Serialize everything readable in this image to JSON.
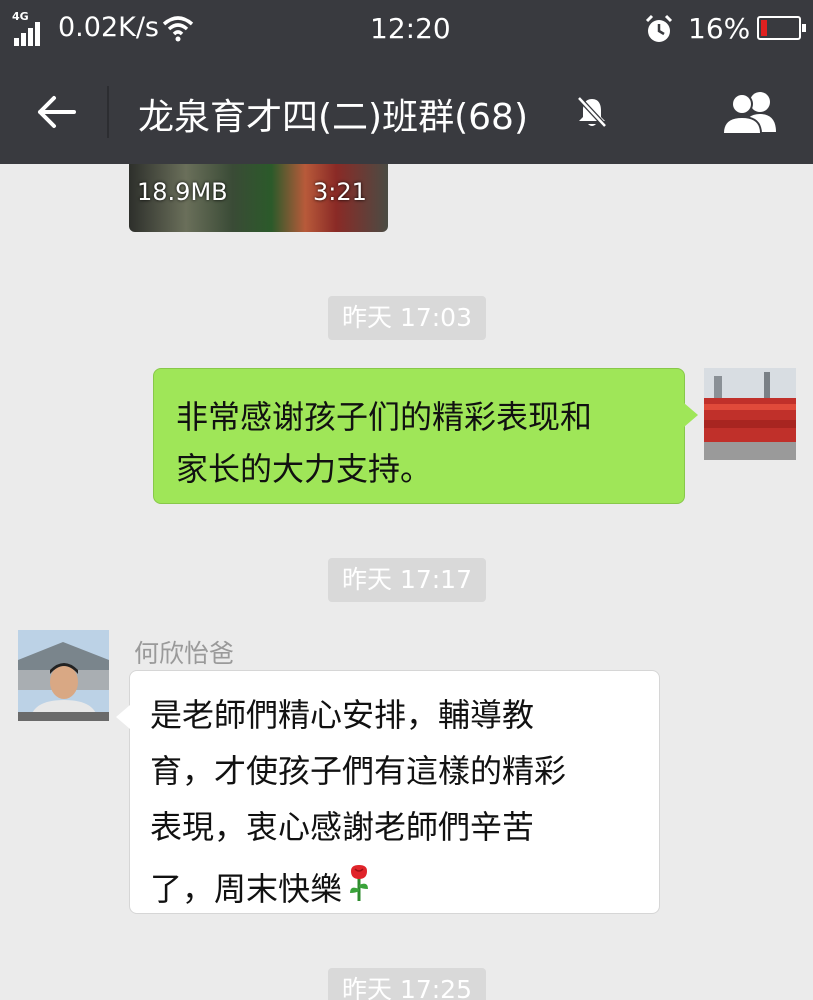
{
  "status_bar": {
    "network": "4G",
    "speed": "0.02K/s",
    "time": "12:20",
    "battery_percent": "16%",
    "battery_level": 0.16,
    "battery_color": "#e02020"
  },
  "header": {
    "title": "龙泉育才四(二)班群(68)",
    "back_icon": "back-arrow-icon",
    "mute_icon": "bell-muted-icon",
    "members_icon": "people-icon"
  },
  "messages": {
    "video": {
      "size": "18.9MB",
      "duration": "3:21"
    },
    "timestamps": [
      "昨天 17:03",
      "昨天 17:17",
      "昨天 17:25"
    ],
    "outgoing": {
      "lines": [
        "非常感谢孩子们的精彩表现和",
        "家长的大力支持。"
      ]
    },
    "incoming": {
      "sender": "何欣怡爸",
      "lines": [
        "是老師們精心安排，輔導教",
        "育，才使孩子們有這樣的精彩",
        "表現，衷心感謝老師們辛苦",
        "了，周末快樂"
      ],
      "emoji": "rose-icon"
    }
  },
  "colors": {
    "header_bg": "#393a3f",
    "chat_bg": "#ebebeb",
    "outgoing_bubble": "#9fe658",
    "incoming_bubble": "#ffffff",
    "timestamp_bg": "#d9d9d9"
  }
}
